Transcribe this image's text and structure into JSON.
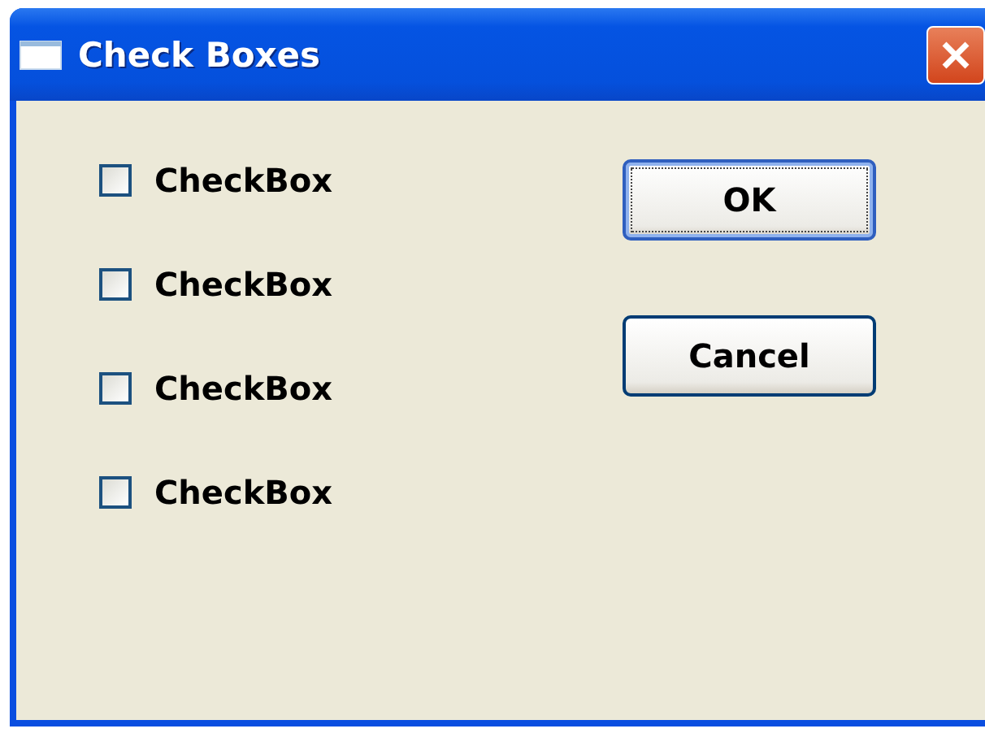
{
  "window": {
    "title": "Check Boxes"
  },
  "checkboxes": [
    {
      "label": "CheckBox",
      "checked": false
    },
    {
      "label": "CheckBox",
      "checked": false
    },
    {
      "label": "CheckBox",
      "checked": false
    },
    {
      "label": "CheckBox",
      "checked": false
    }
  ],
  "buttons": [
    {
      "label": "OK",
      "focused": true
    },
    {
      "label": "Cancel",
      "focused": false
    }
  ]
}
